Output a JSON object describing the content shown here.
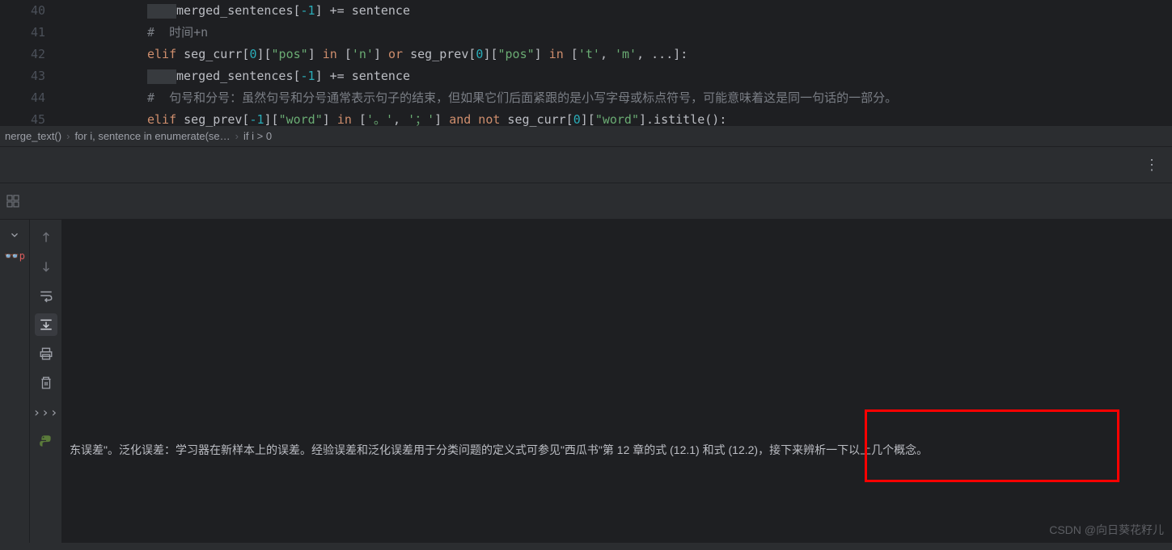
{
  "editor": {
    "line_numbers": [
      "40",
      "41",
      "42",
      "43",
      "44",
      "45"
    ],
    "lines": {
      "l40_part1": "merged_sentences[",
      "l40_idx": "-1",
      "l40_part2": "] += sentence",
      "l41": "#  时间+n",
      "l42_kw1": "elif",
      "l42_p1": " seg_curr[",
      "l42_n1": "0",
      "l42_p2": "][",
      "l42_s1": "\"pos\"",
      "l42_p3": "] ",
      "l42_kw2": "in",
      "l42_p4": " [",
      "l42_s2": "'n'",
      "l42_p5": "] ",
      "l42_kw3": "or",
      "l42_p6": " seg_prev[",
      "l42_n2": "0",
      "l42_p7": "][",
      "l42_s3": "\"pos\"",
      "l42_p8": "] ",
      "l42_kw4": "in",
      "l42_p9": " [",
      "l42_s4": "'t'",
      "l42_p10": ", ",
      "l42_s5": "'m'",
      "l42_p11": ", ...]:",
      "l43_part1": "merged_sentences[",
      "l43_idx": "-1",
      "l43_part2": "] += sentence",
      "l44": "#  句号和分号：虽然句号和分号通常表示句子的结束，但如果它们后面紧跟的是小写字母或标点符号，可能意味着这是同一句话的一部分。",
      "l45_kw1": "elif",
      "l45_p1": " seg_prev[",
      "l45_n1": "-1",
      "l45_p2": "][",
      "l45_s1": "\"word\"",
      "l45_p3": "] ",
      "l45_kw2": "in",
      "l45_p4": " [",
      "l45_s2": "'。'",
      "l45_p5": ", ",
      "l45_s3": "'；'",
      "l45_p6": "] ",
      "l45_kw3": "and not",
      "l45_p7": " seg_curr[",
      "l45_n2": "0",
      "l45_p8": "][",
      "l45_s4": "\"word\"",
      "l45_p9": "].istitle():"
    }
  },
  "breadcrumb": {
    "b1": "nerge_text()",
    "b2": "for i, sentence in enumerate(se…",
    "b3": "if i > 0"
  },
  "console": {
    "output_text": "东误差\"。泛化误差：学习器在新样本上的误差。经验误差和泛化误差用于分类问题的定义式可参见\"西瓜书\"第 12 章的式 (12.1) 和式 (12.2)，接下来辨析一下以上几个概念。"
  },
  "watermark": "CSDN @向日葵花籽儿"
}
